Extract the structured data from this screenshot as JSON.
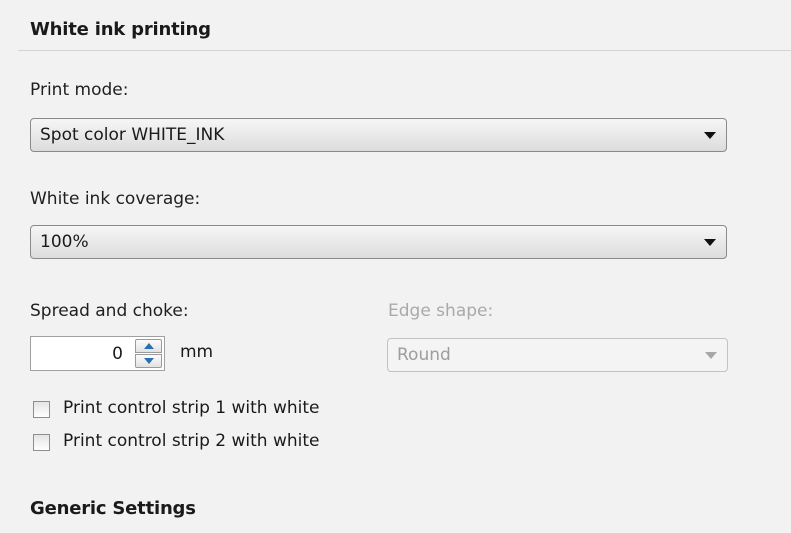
{
  "white_ink_section": {
    "title": "White ink printing",
    "print_mode": {
      "label": "Print mode:",
      "value": "Spot color WHITE_INK"
    },
    "coverage": {
      "label": "White ink coverage:",
      "value": "100%"
    },
    "spread_choke": {
      "label": "Spread and choke:",
      "value": "0",
      "unit": "mm"
    },
    "edge_shape": {
      "label": "Edge shape:",
      "value": "Round",
      "enabled": false
    },
    "checkboxes": [
      {
        "label": "Print control strip 1 with white",
        "checked": false
      },
      {
        "label": "Print control strip 2 with white",
        "checked": false
      }
    ]
  },
  "generic_section": {
    "title": "Generic Settings"
  }
}
